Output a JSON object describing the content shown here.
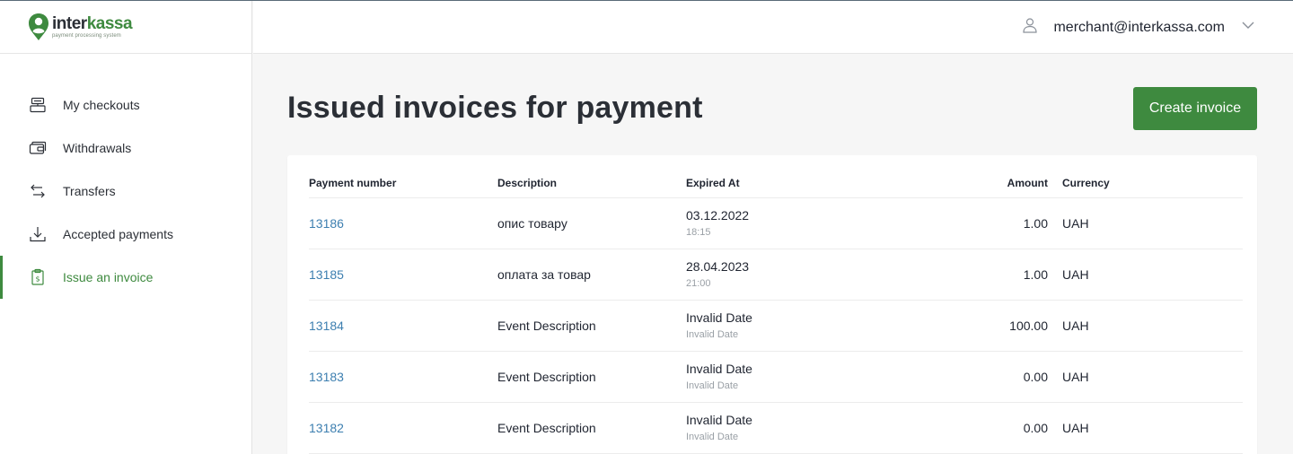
{
  "brand": {
    "word_part1": "inter",
    "word_part2": "kassa",
    "tagline": "payment processing system",
    "color": "#3e8a3f"
  },
  "header": {
    "user_email": "merchant@interkassa.com",
    "user_icon": "user-icon",
    "dropdown_icon": "chevron-down-icon"
  },
  "sidebar": {
    "items": [
      {
        "label": "My checkouts",
        "icon": "checkout-icon",
        "active": false
      },
      {
        "label": "Withdrawals",
        "icon": "wallet-icon",
        "active": false
      },
      {
        "label": "Transfers",
        "icon": "transfer-arrows-icon",
        "active": false
      },
      {
        "label": "Accepted payments",
        "icon": "download-icon",
        "active": false
      },
      {
        "label": "Issue an invoice",
        "icon": "invoice-icon",
        "active": true
      }
    ]
  },
  "main": {
    "title": "Issued invoices for payment",
    "create_button": "Create invoice",
    "table": {
      "columns": [
        "Payment number",
        "Description",
        "Expired At",
        "Amount",
        "Currency"
      ],
      "rows": [
        {
          "number": "13186",
          "description": "опис товару",
          "expired_date": "03.12.2022",
          "expired_time": "18:15",
          "amount": "1.00",
          "currency": "UAH"
        },
        {
          "number": "13185",
          "description": "оплата за товар",
          "expired_date": "28.04.2023",
          "expired_time": "21:00",
          "amount": "1.00",
          "currency": "UAH"
        },
        {
          "number": "13184",
          "description": "Event Description",
          "expired_date": "Invalid Date",
          "expired_time": "Invalid Date",
          "amount": "100.00",
          "currency": "UAH"
        },
        {
          "number": "13183",
          "description": "Event Description",
          "expired_date": "Invalid Date",
          "expired_time": "Invalid Date",
          "amount": "0.00",
          "currency": "UAH"
        },
        {
          "number": "13182",
          "description": "Event Description",
          "expired_date": "Invalid Date",
          "expired_time": "Invalid Date",
          "amount": "0.00",
          "currency": "UAH"
        }
      ]
    }
  }
}
